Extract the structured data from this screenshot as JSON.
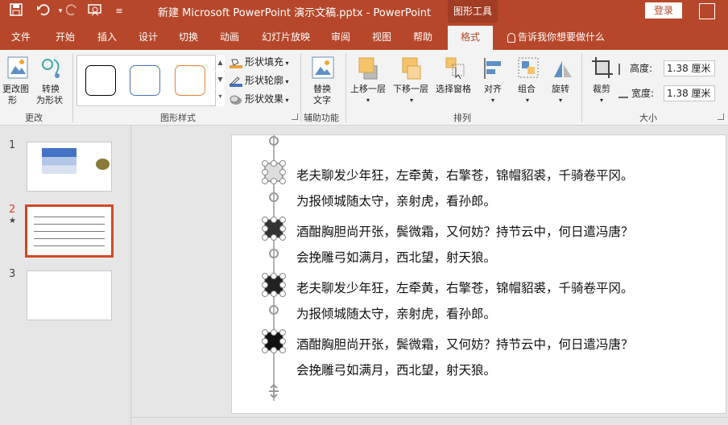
{
  "title_bar": {
    "doc_title": "新建 Microsoft PowerPoint 演示文稿.pptx  -  PowerPoint",
    "tools_tab": "图形工具",
    "login": "登录"
  },
  "tabs": [
    "文件",
    "开始",
    "插入",
    "设计",
    "切换",
    "动画",
    "幻灯片放映",
    "审阅",
    "视图",
    "帮助"
  ],
  "active_tab": "格式",
  "tell_me": "告诉我你想要做什么",
  "ribbon": {
    "change_shape_line1": "更改图",
    "change_shape_line2": "形",
    "convert_line1": "转换",
    "convert_line2": "为形状",
    "group_change": "更改",
    "shape_fill": "形状填充",
    "shape_outline": "形状轮廓",
    "shape_effects": "形状效果",
    "group_styles": "图形样式",
    "alt_text_line1": "替换",
    "alt_text_line2": "文字",
    "group_accessibility": "辅助功能",
    "bring_forward": "上移一层",
    "send_backward": "下移一层",
    "selection_pane": "选择窗格",
    "align": "对齐",
    "group_cmd": "组合",
    "rotate": "旋转",
    "group_arrange": "排列",
    "crop": "裁剪",
    "height_label": "高度:",
    "height_value": "1.38 厘米",
    "width_label": "宽度:",
    "width_value": "1.38 厘米",
    "group_size": "大小"
  },
  "thumbnails": {
    "num1": "1",
    "num2": "2",
    "star": "★",
    "num3": "3"
  },
  "poem_lines": [
    "老夫聊发少年狂，左牵黄，右擎苍，锦帽貂裘，千骑卷平冈。",
    "为报倾城随太守，亲射虎，看孙郎。",
    "酒酣胸胆尚开张，鬓微霜，又何妨？持节云中，何日遣冯唐？",
    "会挽雕弓如满月，西北望，射天狼。",
    "老夫聊发少年狂，左牵黄，右擎苍，锦帽貂裘，千骑卷平冈。",
    "为报倾城随太守，亲射虎，看孙郎。",
    "酒酣胸胆尚开张，鬓微霜，又何妨？持节云中，何日遣冯唐？",
    "会挽雕弓如满月，西北望，射天狼。"
  ],
  "colors": {
    "accent": "#b7472a",
    "ribbon_bg": "#f3f3f3",
    "selected_thumb_border": "#d24726"
  },
  "icons": [
    "save-icon",
    "undo-icon",
    "redo-icon",
    "present-icon",
    "customize-icon",
    "lightbulb-icon"
  ]
}
